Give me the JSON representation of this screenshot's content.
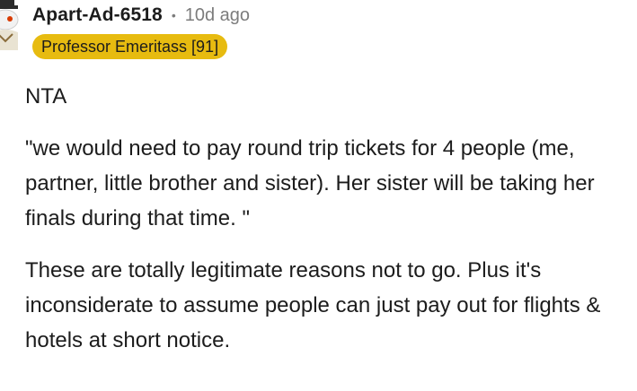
{
  "comment": {
    "username": "Apart-Ad-6518",
    "separator": "•",
    "age": "10d ago",
    "flair": {
      "text": "Professor Emeritass [91]",
      "color": "#e7bb10"
    },
    "avatar_icon": "snoo-avatar-icon",
    "paragraphs": [
      "NTA",
      "\"we would need to pay round trip tickets for 4 people (me, partner, little brother and sister). Her sister will be taking her finals during that time. \"",
      "These are totally legitimate reasons not to go. Plus it's inconsiderate to assume people can just pay out for flights & hotels at short notice."
    ]
  },
  "colors": {
    "text": "#1c1c1c",
    "meta": "#7c7c7c",
    "background": "#ffffff"
  }
}
